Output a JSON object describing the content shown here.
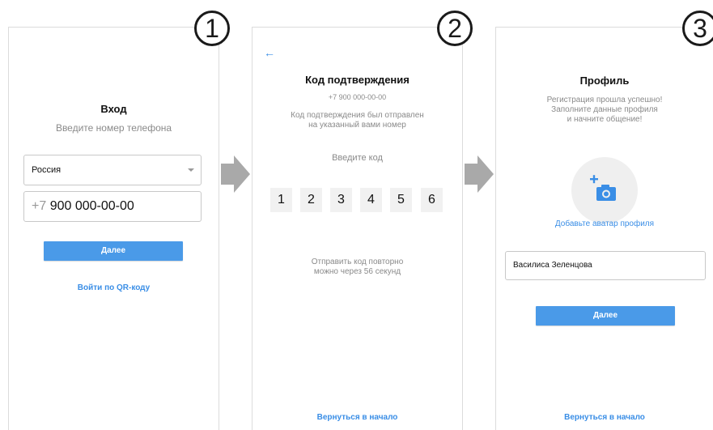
{
  "steps": [
    "1",
    "2",
    "3"
  ],
  "login": {
    "title": "Вход",
    "subtitle": "Введите номер телефона",
    "country": "Россия",
    "phone_code": "+7",
    "phone_number": "900 000-00-00",
    "next_button": "Далее",
    "qr_link": "Войти по QR-коду"
  },
  "code": {
    "title": "Код подтверждения",
    "phone": "+7 900 000-00-00",
    "info_line1": "Код подтверждения был отправлен",
    "info_line2": "на указанный вами номер",
    "prompt": "Введите код",
    "digits": [
      "1",
      "2",
      "3",
      "4",
      "5",
      "6"
    ],
    "resend_line1": "Отправить код повторно",
    "resend_line2": "можно через 56 секунд",
    "back_link": "Вернуться в начало"
  },
  "profile": {
    "title": "Профиль",
    "info_line1": "Регистрация прошла успешно!",
    "info_line2": "Заполните данные профиля",
    "info_line3": "и начните общение!",
    "avatar_link": "Добавьте аватар профиля",
    "name_value": "Василиса Зеленцова",
    "next_button": "Далее",
    "back_link": "Вернуться в начало"
  },
  "colors": {
    "accent": "#3a8ee6",
    "button": "#4a9ae8",
    "arrow": "#a9a9a9"
  }
}
